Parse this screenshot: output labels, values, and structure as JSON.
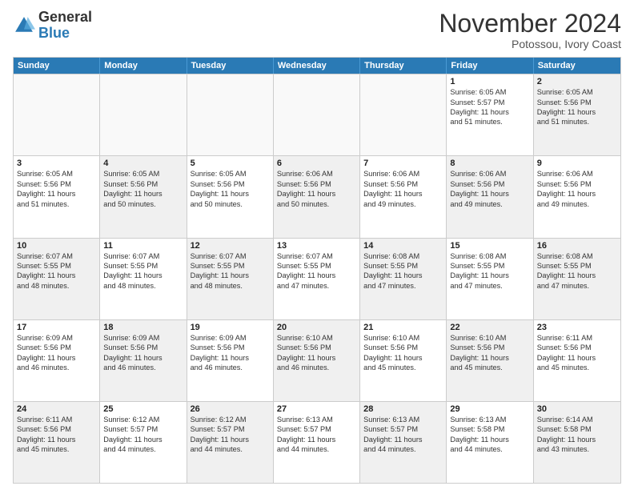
{
  "header": {
    "logo_general": "General",
    "logo_blue": "Blue",
    "month": "November 2024",
    "location": "Potossou, Ivory Coast"
  },
  "weekdays": [
    "Sunday",
    "Monday",
    "Tuesday",
    "Wednesday",
    "Thursday",
    "Friday",
    "Saturday"
  ],
  "rows": [
    [
      {
        "day": "",
        "info": "",
        "empty": true
      },
      {
        "day": "",
        "info": "",
        "empty": true
      },
      {
        "day": "",
        "info": "",
        "empty": true
      },
      {
        "day": "",
        "info": "",
        "empty": true
      },
      {
        "day": "",
        "info": "",
        "empty": true
      },
      {
        "day": "1",
        "info": "Sunrise: 6:05 AM\nSunset: 5:57 PM\nDaylight: 11 hours\nand 51 minutes.",
        "empty": false
      },
      {
        "day": "2",
        "info": "Sunrise: 6:05 AM\nSunset: 5:56 PM\nDaylight: 11 hours\nand 51 minutes.",
        "empty": false,
        "shaded": true
      }
    ],
    [
      {
        "day": "3",
        "info": "Sunrise: 6:05 AM\nSunset: 5:56 PM\nDaylight: 11 hours\nand 51 minutes.",
        "empty": false
      },
      {
        "day": "4",
        "info": "Sunrise: 6:05 AM\nSunset: 5:56 PM\nDaylight: 11 hours\nand 50 minutes.",
        "empty": false,
        "shaded": true
      },
      {
        "day": "5",
        "info": "Sunrise: 6:05 AM\nSunset: 5:56 PM\nDaylight: 11 hours\nand 50 minutes.",
        "empty": false
      },
      {
        "day": "6",
        "info": "Sunrise: 6:06 AM\nSunset: 5:56 PM\nDaylight: 11 hours\nand 50 minutes.",
        "empty": false,
        "shaded": true
      },
      {
        "day": "7",
        "info": "Sunrise: 6:06 AM\nSunset: 5:56 PM\nDaylight: 11 hours\nand 49 minutes.",
        "empty": false
      },
      {
        "day": "8",
        "info": "Sunrise: 6:06 AM\nSunset: 5:56 PM\nDaylight: 11 hours\nand 49 minutes.",
        "empty": false,
        "shaded": true
      },
      {
        "day": "9",
        "info": "Sunrise: 6:06 AM\nSunset: 5:56 PM\nDaylight: 11 hours\nand 49 minutes.",
        "empty": false
      }
    ],
    [
      {
        "day": "10",
        "info": "Sunrise: 6:07 AM\nSunset: 5:55 PM\nDaylight: 11 hours\nand 48 minutes.",
        "empty": false,
        "shaded": true
      },
      {
        "day": "11",
        "info": "Sunrise: 6:07 AM\nSunset: 5:55 PM\nDaylight: 11 hours\nand 48 minutes.",
        "empty": false
      },
      {
        "day": "12",
        "info": "Sunrise: 6:07 AM\nSunset: 5:55 PM\nDaylight: 11 hours\nand 48 minutes.",
        "empty": false,
        "shaded": true
      },
      {
        "day": "13",
        "info": "Sunrise: 6:07 AM\nSunset: 5:55 PM\nDaylight: 11 hours\nand 47 minutes.",
        "empty": false
      },
      {
        "day": "14",
        "info": "Sunrise: 6:08 AM\nSunset: 5:55 PM\nDaylight: 11 hours\nand 47 minutes.",
        "empty": false,
        "shaded": true
      },
      {
        "day": "15",
        "info": "Sunrise: 6:08 AM\nSunset: 5:55 PM\nDaylight: 11 hours\nand 47 minutes.",
        "empty": false
      },
      {
        "day": "16",
        "info": "Sunrise: 6:08 AM\nSunset: 5:55 PM\nDaylight: 11 hours\nand 47 minutes.",
        "empty": false,
        "shaded": true
      }
    ],
    [
      {
        "day": "17",
        "info": "Sunrise: 6:09 AM\nSunset: 5:56 PM\nDaylight: 11 hours\nand 46 minutes.",
        "empty": false
      },
      {
        "day": "18",
        "info": "Sunrise: 6:09 AM\nSunset: 5:56 PM\nDaylight: 11 hours\nand 46 minutes.",
        "empty": false,
        "shaded": true
      },
      {
        "day": "19",
        "info": "Sunrise: 6:09 AM\nSunset: 5:56 PM\nDaylight: 11 hours\nand 46 minutes.",
        "empty": false
      },
      {
        "day": "20",
        "info": "Sunrise: 6:10 AM\nSunset: 5:56 PM\nDaylight: 11 hours\nand 46 minutes.",
        "empty": false,
        "shaded": true
      },
      {
        "day": "21",
        "info": "Sunrise: 6:10 AM\nSunset: 5:56 PM\nDaylight: 11 hours\nand 45 minutes.",
        "empty": false
      },
      {
        "day": "22",
        "info": "Sunrise: 6:10 AM\nSunset: 5:56 PM\nDaylight: 11 hours\nand 45 minutes.",
        "empty": false,
        "shaded": true
      },
      {
        "day": "23",
        "info": "Sunrise: 6:11 AM\nSunset: 5:56 PM\nDaylight: 11 hours\nand 45 minutes.",
        "empty": false
      }
    ],
    [
      {
        "day": "24",
        "info": "Sunrise: 6:11 AM\nSunset: 5:56 PM\nDaylight: 11 hours\nand 45 minutes.",
        "empty": false,
        "shaded": true
      },
      {
        "day": "25",
        "info": "Sunrise: 6:12 AM\nSunset: 5:57 PM\nDaylight: 11 hours\nand 44 minutes.",
        "empty": false
      },
      {
        "day": "26",
        "info": "Sunrise: 6:12 AM\nSunset: 5:57 PM\nDaylight: 11 hours\nand 44 minutes.",
        "empty": false,
        "shaded": true
      },
      {
        "day": "27",
        "info": "Sunrise: 6:13 AM\nSunset: 5:57 PM\nDaylight: 11 hours\nand 44 minutes.",
        "empty": false
      },
      {
        "day": "28",
        "info": "Sunrise: 6:13 AM\nSunset: 5:57 PM\nDaylight: 11 hours\nand 44 minutes.",
        "empty": false,
        "shaded": true
      },
      {
        "day": "29",
        "info": "Sunrise: 6:13 AM\nSunset: 5:58 PM\nDaylight: 11 hours\nand 44 minutes.",
        "empty": false
      },
      {
        "day": "30",
        "info": "Sunrise: 6:14 AM\nSunset: 5:58 PM\nDaylight: 11 hours\nand 43 minutes.",
        "empty": false,
        "shaded": true
      }
    ]
  ]
}
